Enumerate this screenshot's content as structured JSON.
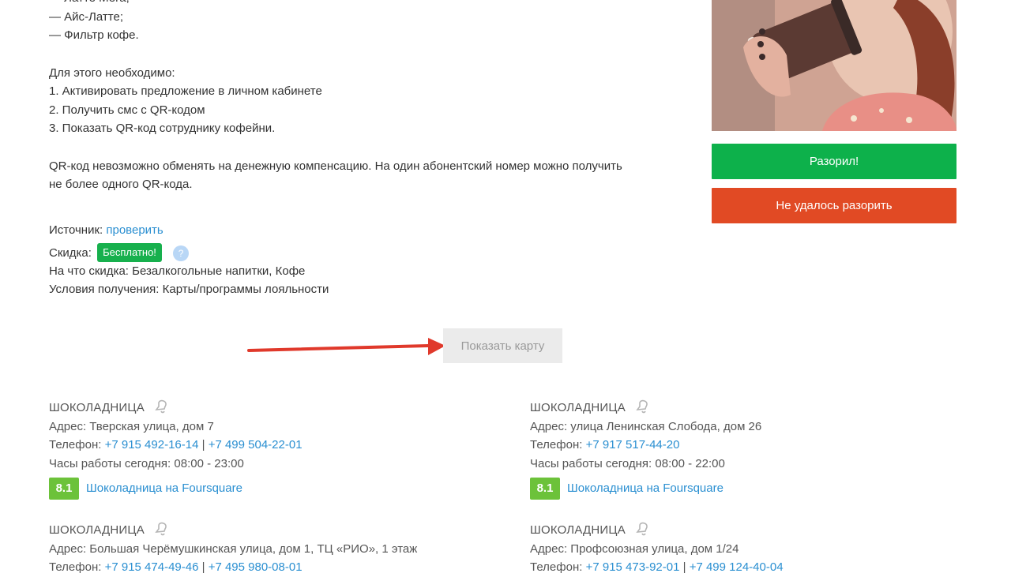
{
  "description": {
    "list_items": [
      "— Латте Мега;",
      "— Айс-Латте;",
      "— Фильтр кофе."
    ],
    "steps_title": "Для этого необходимо:",
    "steps": [
      "1. Активировать предложение в личном кабинете",
      "2. Получить смс с QR-кодом",
      "3. Показать QR-код сотруднику кофейни."
    ],
    "note_line1": "QR-код невозможно обменять на денежную компенсацию. На один абонентский номер можно получить",
    "note_line2": "не более одного QR-кода."
  },
  "details": {
    "source_label": "Источник:",
    "source_link": "проверить",
    "discount_label": "Скидка:",
    "discount_badge": "Бесплатно!",
    "help": "?",
    "category_label": "На что скидка:",
    "category_value": "Безалкогольные напитки, Кофе",
    "conditions_label": "Условия получения:",
    "conditions_value": "Карты/программы лояльности"
  },
  "actions": {
    "success": "Разорил!",
    "fail": "Не удалось разорить",
    "show_map": "Показать карту"
  },
  "colors": {
    "success": "#0db14b",
    "fail": "#e14a24",
    "link": "#2a8fd1",
    "rating": "#6cc23a",
    "badge": "#17b04d",
    "arrow": "#e0392b"
  },
  "stores": [
    {
      "name": "ШОКОЛАДНИЦА",
      "address_label": "Адрес:",
      "address": "Тверская улица, дом 7",
      "phone_label": "Телефон:",
      "phones": [
        "+7 915 492-16-14",
        "+7 499 504-22-01"
      ],
      "hours_label": "Часы работы сегодня:",
      "hours": "08:00 - 23:00",
      "rating": "8.1",
      "foursquare": "Шоколадница на Foursquare"
    },
    {
      "name": "ШОКОЛАДНИЦА",
      "address_label": "Адрес:",
      "address": "улица Ленинская Слобода, дом 26",
      "phone_label": "Телефон:",
      "phones": [
        "+7 917 517-44-20"
      ],
      "hours_label": "Часы работы сегодня:",
      "hours": "08:00 - 22:00",
      "rating": "8.1",
      "foursquare": "Шоколадница на Foursquare"
    },
    {
      "name": "ШОКОЛАДНИЦА",
      "address_label": "Адрес:",
      "address": "Большая Черёмушкинская улица, дом 1, ТЦ «РИО», 1 этаж",
      "phone_label": "Телефон:",
      "phones": [
        "+7 915 474-49-46",
        "+7 495 980-08-01"
      ]
    },
    {
      "name": "ШОКОЛАДНИЦА",
      "address_label": "Адрес:",
      "address": "Профсоюзная улица, дом 1/24",
      "phone_label": "Телефон:",
      "phones": [
        "+7 915 473-92-01",
        "+7 499 124-40-04"
      ]
    }
  ],
  "partial_list_item": "— Латте Мега;"
}
